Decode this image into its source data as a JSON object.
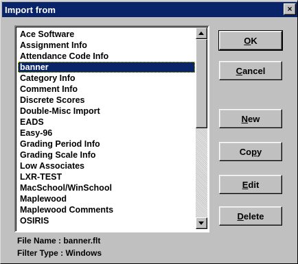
{
  "window": {
    "title": "Import from",
    "close_glyph": "×"
  },
  "list": {
    "items": [
      "Ace Software",
      "Assignment Info",
      "Attendance Code Info",
      "banner",
      "Category Info",
      "Comment Info",
      "Discrete Scores",
      "Double-Misc Import",
      "EADS",
      "Easy-96",
      "Grading Period Info",
      "Grading Scale Info",
      "Low Associates",
      "LXR-TEST",
      "MacSchool/WinSchool",
      "Maplewood",
      "Maplewood Comments",
      "OSIRIS"
    ],
    "selected_index": 3
  },
  "buttons": {
    "ok": {
      "pre": "",
      "accel": "O",
      "post": "K"
    },
    "cancel": {
      "pre": "",
      "accel": "C",
      "post": "ancel"
    },
    "new": {
      "pre": "",
      "accel": "N",
      "post": "ew"
    },
    "copy": {
      "pre": "Co",
      "accel": "p",
      "post": "y"
    },
    "edit": {
      "pre": "",
      "accel": "E",
      "post": "dit"
    },
    "delete": {
      "pre": "",
      "accel": "D",
      "post": "elete"
    }
  },
  "info": {
    "file_name": "File Name  : banner.flt",
    "filter_type": "Filter Type : Windows"
  },
  "colors": {
    "titlebar": "#0a246a",
    "face": "#c0c0c0",
    "selection": "#0a246a"
  }
}
